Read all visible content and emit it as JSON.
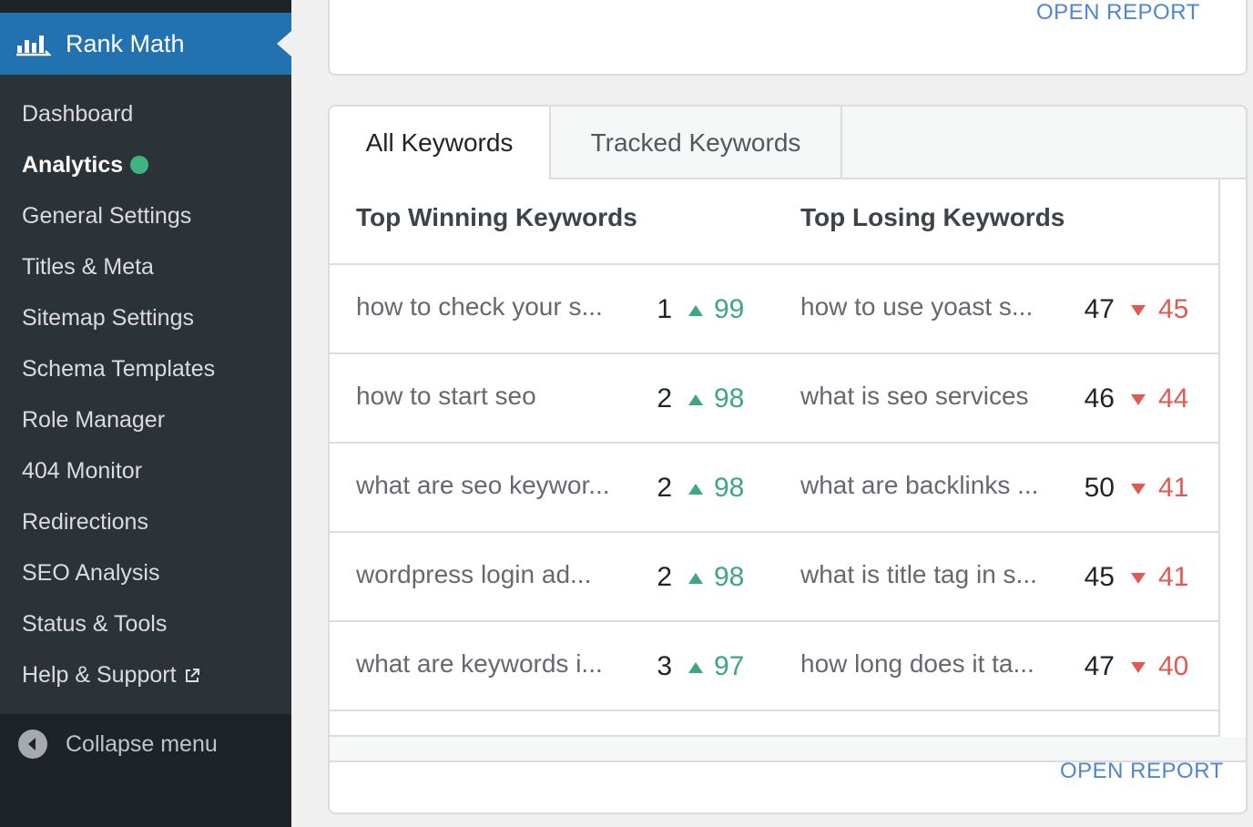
{
  "sidebar": {
    "brand": "Rank Math",
    "items": [
      {
        "label": "Dashboard"
      },
      {
        "label": "Analytics",
        "active": true
      },
      {
        "label": "General Settings"
      },
      {
        "label": "Titles & Meta"
      },
      {
        "label": "Sitemap Settings"
      },
      {
        "label": "Schema Templates"
      },
      {
        "label": "Role Manager"
      },
      {
        "label": "404 Monitor"
      },
      {
        "label": "Redirections"
      },
      {
        "label": "SEO Analysis"
      },
      {
        "label": "Status & Tools"
      },
      {
        "label": "Help & Support"
      }
    ],
    "collapse_label": "Collapse menu"
  },
  "top_card": {
    "open_report": "OPEN REPORT"
  },
  "keywords_card": {
    "tabs": [
      "All Keywords",
      "Tracked Keywords"
    ],
    "winning_title": "Top Winning Keywords",
    "losing_title": "Top Losing Keywords",
    "winning": [
      {
        "keyword": "how to check your s...",
        "position": "1",
        "diff": "99"
      },
      {
        "keyword": "how to start seo",
        "position": "2",
        "diff": "98"
      },
      {
        "keyword": "what are seo keywor...",
        "position": "2",
        "diff": "98"
      },
      {
        "keyword": "wordpress login ad...",
        "position": "2",
        "diff": "98"
      },
      {
        "keyword": "what are keywords i...",
        "position": "3",
        "diff": "97"
      }
    ],
    "losing": [
      {
        "keyword": "how to use yoast s...",
        "position": "47",
        "diff": "45"
      },
      {
        "keyword": "what is seo services",
        "position": "46",
        "diff": "44"
      },
      {
        "keyword": "what are backlinks ...",
        "position": "50",
        "diff": "41"
      },
      {
        "keyword": "what is title tag in s...",
        "position": "45",
        "diff": "41"
      },
      {
        "keyword": "how long does it ta...",
        "position": "47",
        "diff": "40"
      }
    ],
    "open_report": "OPEN REPORT"
  },
  "colors": {
    "sidebar_bg": "#2c3338",
    "brand_bg": "#2271b1",
    "active_dot": "#3fb37f",
    "gain": "#3ea77f",
    "loss": "#e05a52",
    "link": "#4f86d4"
  }
}
